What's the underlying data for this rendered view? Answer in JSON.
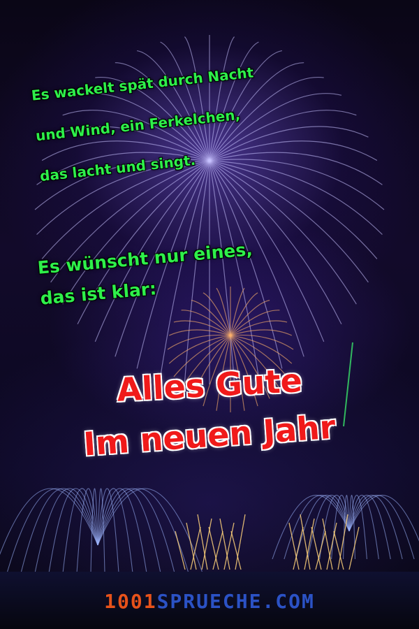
{
  "image": {
    "scene": "fireworks-night-sky",
    "colors": {
      "poem_text": "#2ef04a",
      "greeting_text": "#f01a1a",
      "greeting_outline": "#ffffff",
      "watermark_number": "#ff5a1a",
      "watermark_word": "#2f5ad8"
    }
  },
  "poem": {
    "stanza1": [
      "Es wackelt spät durch Nacht",
      "und Wind, ein Ferkelchen,",
      "das lacht und singt."
    ],
    "stanza2": [
      "Es wünscht nur eines,",
      "das ist klar:"
    ]
  },
  "greeting": [
    "Alles Gute",
    "Im neuen Jahr"
  ],
  "watermark": {
    "number": "1001",
    "word": "SPRUECHE.COM"
  }
}
